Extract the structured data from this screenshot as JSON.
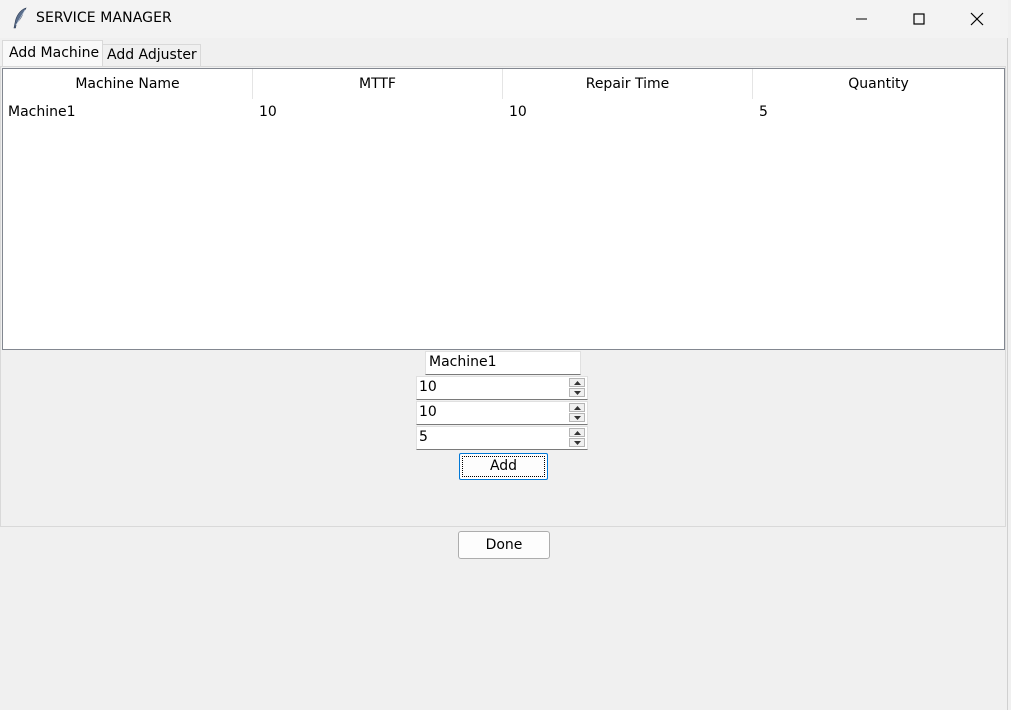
{
  "window": {
    "title": "SERVICE MANAGER",
    "icon": "feather-icon"
  },
  "window_controls": [
    "minimize-icon",
    "maximize-icon",
    "close-icon"
  ],
  "tabs": [
    {
      "label": "Add Machine",
      "active": true
    },
    {
      "label": "Add Adjuster",
      "active": false
    }
  ],
  "table": {
    "columns": [
      "Machine Name",
      "MTTF",
      "Repair Time",
      "Quantity"
    ],
    "rows": [
      [
        "Machine1",
        "10",
        "10",
        "5"
      ]
    ]
  },
  "form": {
    "name_value": "Machine1",
    "mttf_value": "10",
    "repair_time_value": "10",
    "quantity_value": "5",
    "add_label": "Add"
  },
  "footer": {
    "done_label": "Done"
  }
}
